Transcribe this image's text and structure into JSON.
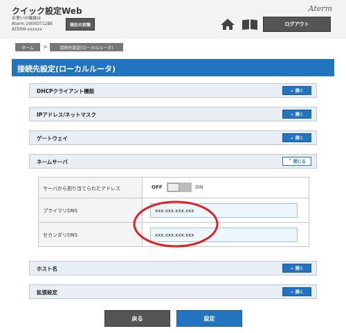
{
  "header": {
    "title": "クイック設定Web",
    "device_line1": "お使いの機器は",
    "device_line2": "Aterm 1900OT12BE",
    "device_line3": "ATERM-xxxxxx",
    "status_button": "現在の状態",
    "brand": "Aterm",
    "icons": [
      "home-icon",
      "book-icon"
    ],
    "logout_button": "ログアウト"
  },
  "breadcrumb": {
    "home": "ホーム",
    "separator": ">",
    "current": "接続先設定(ローカルルータ)"
  },
  "page": {
    "title": "接続先設定(ローカルルータ)"
  },
  "sections": [
    {
      "title": "DHCPクライアント機能",
      "toggle_label": "開く",
      "expanded": false
    },
    {
      "title": "IPアドレス/ネットマスク",
      "toggle_label": "開く",
      "expanded": false
    },
    {
      "title": "ゲートウェイ",
      "toggle_label": "開く",
      "expanded": false
    },
    {
      "title": "ネームサーバ",
      "toggle_label": "閉じる",
      "expanded": true
    },
    {
      "title": "ホスト名",
      "toggle_label": "開く",
      "expanded": false
    },
    {
      "title": "拡張設定",
      "toggle_label": "開く",
      "expanded": false
    }
  ],
  "name_server": {
    "auto_assign_label": "サーバから割り当てられたアドレス",
    "toggle_off": "OFF",
    "toggle_on": "ON",
    "auto_assign_state": "OFF",
    "primary_label": "プライマリDNS",
    "primary_value": "xxx.xxx.xxx.xxx",
    "secondary_label": "セカンダリDNS",
    "secondary_value": "xxx.xxx.xxx.xxx"
  },
  "buttons": {
    "back": "戻る",
    "submit": "設定"
  },
  "colors": {
    "accent": "#2274c0",
    "header_bg": "#f3f3f3",
    "annotation": "#e31e24"
  }
}
